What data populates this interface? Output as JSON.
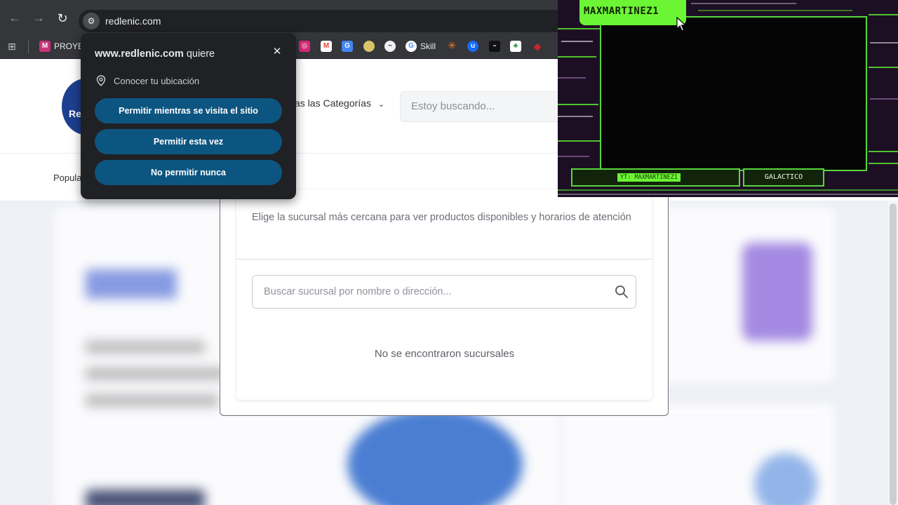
{
  "browser": {
    "url": "redlenic.com",
    "bookmarks": [
      {
        "label": "PROYEC",
        "icon": "m-favicon-icon",
        "color": "#c8337a"
      },
      {
        "label": "",
        "icon": "instagram-icon",
        "color": "#d62976"
      },
      {
        "label": "",
        "icon": "gmail-icon",
        "color": "#ea4335"
      },
      {
        "label": "",
        "icon": "translate-icon",
        "color": "#4285f4"
      },
      {
        "label": "",
        "icon": "bookmark-icon",
        "color": "#d9c36b"
      },
      {
        "label": "",
        "icon": "swirl-icon",
        "color": "#f1f1f1"
      },
      {
        "label": "Skill",
        "icon": "google-icon",
        "color": "#4285f4"
      },
      {
        "label": "",
        "icon": "asterisk-icon",
        "color": "#f47b20"
      },
      {
        "label": "",
        "icon": "u-icon",
        "color": "#1769ff"
      },
      {
        "label": "",
        "icon": "dark-badge-icon",
        "color": "#111111"
      },
      {
        "label": "",
        "icon": "green-leaf-icon",
        "color": "#2e9e3f"
      },
      {
        "label": "",
        "icon": "red-icon",
        "color": "#c62828"
      }
    ]
  },
  "permission_popup": {
    "site": "www.redlenic.com",
    "verb": "quiere",
    "request": "Conocer tu ubicación",
    "buttons": [
      "Permitir mientras se visita el sitio",
      "Permitir esta vez",
      "No permitir nunca"
    ]
  },
  "site": {
    "logo_text": "Re",
    "categories_label": "as las Categorías",
    "search_placeholder": "Estoy buscando...",
    "nav_popular": "Popula"
  },
  "branch_modal": {
    "description": "Elige la sucursal más cercana para ver productos disponibles y horarios de atención",
    "search_placeholder": "Buscar sucursal por nombre o dirección...",
    "empty_message": "No se encontraron sucursales"
  },
  "stream_overlay": {
    "name": "MAXMARTINEZ1",
    "handle": "YT: MAXMARTINEZ1",
    "tag": "GALACTICO",
    "accent_color": "#6cf535"
  }
}
